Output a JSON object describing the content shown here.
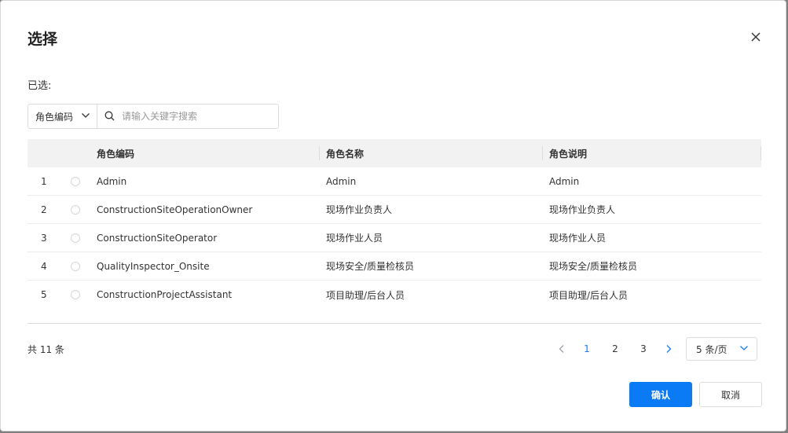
{
  "dialog": {
    "title": "选择",
    "selected_label": "已选:"
  },
  "search": {
    "field_label": "角色编码",
    "placeholder": "请输入关键字搜索",
    "value": ""
  },
  "table": {
    "headers": {
      "code": "角色编码",
      "name": "角色名称",
      "desc": "角色说明"
    },
    "rows": [
      {
        "index": "1",
        "code": "Admin",
        "name": "Admin",
        "desc": "Admin"
      },
      {
        "index": "2",
        "code": "ConstructionSiteOperationOwner",
        "name": "现场作业负责人",
        "desc": "现场作业负责人"
      },
      {
        "index": "3",
        "code": "ConstructionSiteOperator",
        "name": "现场作业人员",
        "desc": "现场作业人员"
      },
      {
        "index": "4",
        "code": "QualityInspector_Onsite",
        "name": "现场安全/质量检核员",
        "desc": "现场安全/质量检核员"
      },
      {
        "index": "5",
        "code": "ConstructionProjectAssistant",
        "name": "项目助理/后台人员",
        "desc": "项目助理/后台人员"
      }
    ]
  },
  "pagination": {
    "total_text": "共 11 条",
    "pages": [
      "1",
      "2",
      "3"
    ],
    "current_page": "1",
    "page_size": "5 条/页"
  },
  "footer": {
    "confirm_label": "确认",
    "cancel_label": "取消"
  },
  "colors": {
    "primary": "#0a7bf5",
    "header_bg": "#f2f2f2"
  },
  "icons": {
    "close": "close-icon",
    "search": "search-icon",
    "dropdown": "chevron-down-icon",
    "prev": "chevron-left-icon",
    "next": "chevron-right-icon"
  }
}
